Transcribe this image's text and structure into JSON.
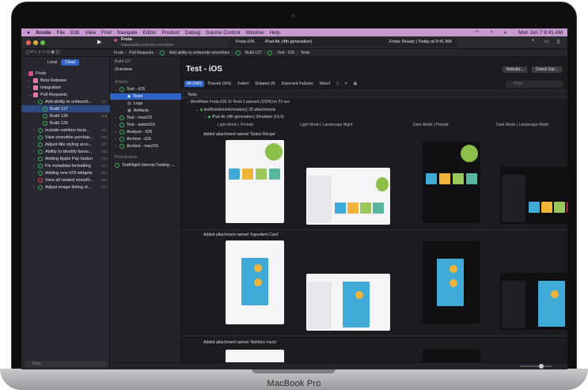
{
  "device_label": "MacBook Pro",
  "menubar": {
    "app": "Xcode",
    "items": [
      "File",
      "Edit",
      "View",
      "Find",
      "Navigate",
      "Editor",
      "Product",
      "Debug",
      "Source Control",
      "Window",
      "Help"
    ],
    "clock": "Mon Jun 7  9:41 AM"
  },
  "toolbar": {
    "project": "Fruta",
    "branch": "feature/add-unfavorite-smoothies",
    "scheme": "Fruta iOS",
    "destination": "iPad Air (4th generation)",
    "status": "Fruta: Ready | Today at 9:41 AM"
  },
  "breadcrumbs": [
    "Fruta",
    "Pull Requests",
    "Add ability to unfavorite smoothies",
    "Build 127",
    "Test - iOS",
    "Tests"
  ],
  "sidebar": {
    "seg_local": "Local",
    "seg_cloud": "Cloud",
    "items": [
      {
        "label": "Fruta",
        "num": ""
      },
      {
        "label": "Beta Release",
        "num": ""
      },
      {
        "label": "Integration",
        "num": ""
      },
      {
        "label": "Pull Requests",
        "num": ""
      },
      {
        "label": "Add ability to unfavorit...",
        "num": "#37"
      },
      {
        "label": "Build 127",
        "num": ""
      },
      {
        "label": "Build 126",
        "num": "⚠ 1"
      },
      {
        "label": "Build 125",
        "num": ""
      },
      {
        "label": "Include nutrition facts...",
        "num": "#31"
      },
      {
        "label": "View smoothie purchas...",
        "num": "#28"
      },
      {
        "label": "Adjust title styling acro...",
        "num": "#27"
      },
      {
        "label": "Ability to identify favou...",
        "num": "#26"
      },
      {
        "label": "Adding Apple Pay button",
        "num": "#25"
      },
      {
        "label": "Fix metadata formatting",
        "num": "#24"
      },
      {
        "label": "Adding new iOS widgets",
        "num": "#23"
      },
      {
        "label": "View all related smooth...",
        "num": "#22"
      },
      {
        "label": "Adjust image tinting st...",
        "num": "#21"
      }
    ],
    "filter_placeholder": "Filter"
  },
  "panel2": {
    "build": "Build 127",
    "overview": "Overview",
    "actions_header": "Actions",
    "items": [
      "Test - iOS",
      "Tests",
      "Logs",
      "Artifacts",
      "Test - macOS",
      "Test - watchOS",
      "Analyze - iOS",
      "Archive - iOS",
      "Archive - macOS"
    ],
    "post_header": "Post-Actions",
    "post_item": "TestFlight Internal Testing -..."
  },
  "content": {
    "title": "Test - iOS",
    "rebuild": "Rebuild...",
    "checkout": "Check Out...",
    "tabs": [
      "All (340)",
      "Passed (343)",
      "Failed",
      "Skipped (4)",
      "Expected Failures",
      "Mixed"
    ],
    "filter_placeholder": "Filter",
    "section": "Tests",
    "workflow": "Workflows   Fruta iOS UI Tests    1 passed (100%) in 22 sec",
    "test_case": "testNutritionInformation()  28 attachments",
    "device": "iPad Air (4th generation) Simulator (15.0)",
    "columns": [
      "Light Mode | Portrait",
      "Light Mode | Landscape Right",
      "Dark Mode | Portrait",
      "Dark Mode | Landscape Right"
    ],
    "attachments": [
      "Added attachment named 'Select Recipe'",
      "Added attachment named 'Ingredient Card'",
      "Added attachment named 'Nutrition Facts'"
    ]
  },
  "colors": {
    "accent": "#2f63c5",
    "menubar": "#c79ad2",
    "pass": "#3cb55a",
    "fail": "#e0483e"
  }
}
